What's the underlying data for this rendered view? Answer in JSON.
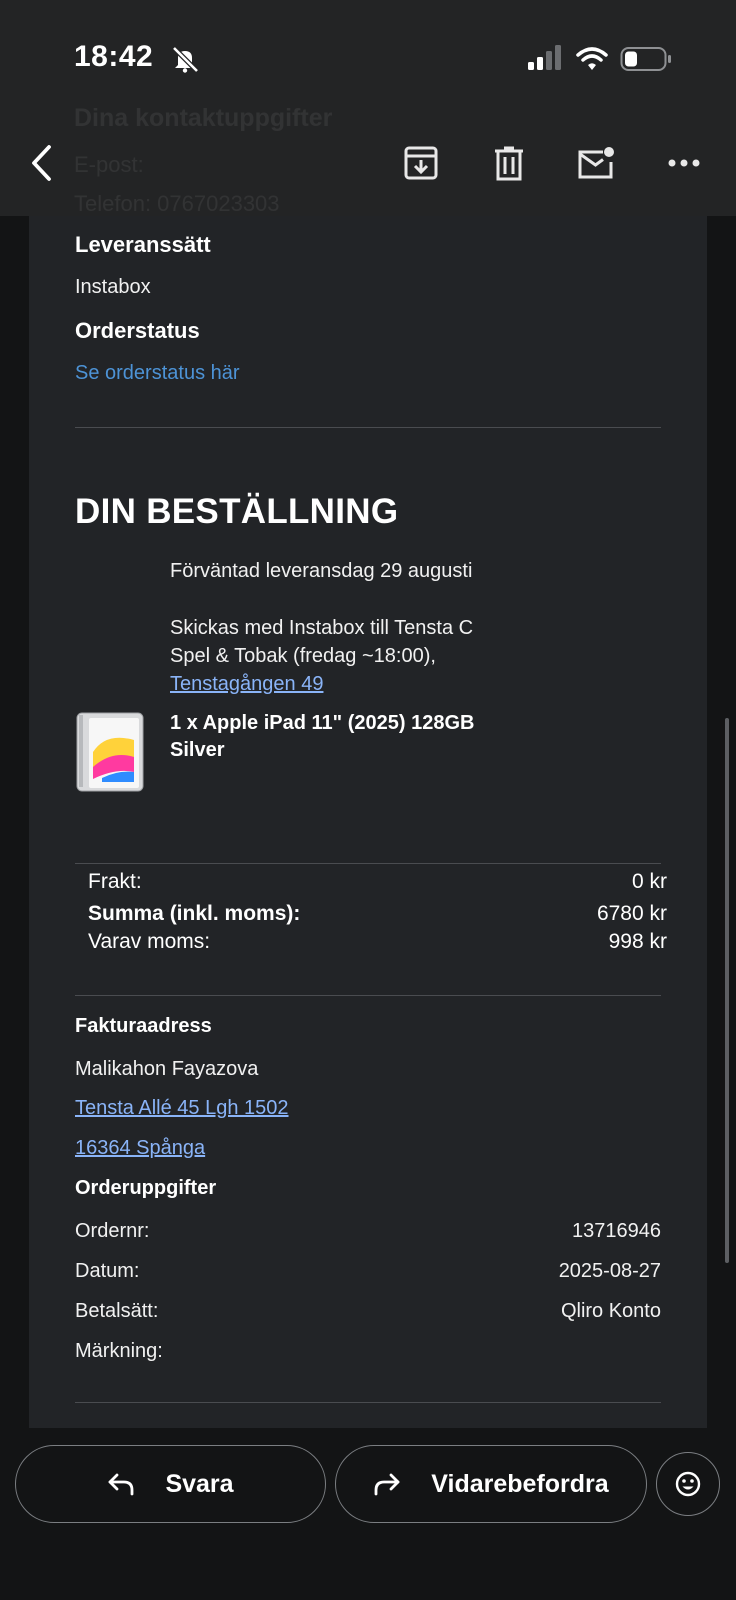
{
  "status_bar": {
    "time": "18:42"
  },
  "header_ghost": {
    "line1": "Dina kontaktuppgifter",
    "line2": "E-post: ",
    "line3": "Telefon: 0767023303"
  },
  "email": {
    "delivery_heading": "Leveranssätt",
    "delivery_value": "Instabox",
    "orderstatus_heading": "Orderstatus",
    "orderstatus_link": "Se orderstatus här",
    "order_title": "DIN BESTÄLLNING",
    "expected_delivery": "Förväntad leveransdag 29 augusti",
    "shipping_line1": "Skickas med Instabox till Tensta C",
    "shipping_line2": "Spel & Tobak (fredag ~18:00),",
    "shipping_address_link": "Tenstagången 49",
    "product_line1": "1 x Apple iPad 11\" (2025) 128GB",
    "product_line2": "Silver",
    "summary": {
      "shipping_label": "Frakt:",
      "shipping_value": "0 kr",
      "total_label": "Summa (inkl. moms):",
      "total_value": "6780 kr",
      "vat_label": "Varav moms:",
      "vat_value": "998 kr"
    },
    "billing": {
      "heading": "Fakturaadress",
      "name": "Malikahon Fayazova",
      "street_link": "Tensta Allé 45 Lgh 1502",
      "postal_link": "16364 Spånga"
    },
    "order_details": {
      "heading": "Orderuppgifter",
      "order_no_label": "Ordernr:",
      "order_no_value": "13716946",
      "date_label": "Datum:",
      "date_value": "2025-08-27",
      "payment_label": "Betalsätt:",
      "payment_value": "Qliro Konto",
      "marking_label": "Märkning:",
      "marking_value": ""
    }
  },
  "actions": {
    "reply_label": "Svara",
    "forward_label": "Vidarebefordra"
  },
  "icons": [
    "back-arrow-icon",
    "archive-icon",
    "trash-icon",
    "mark-unread-icon",
    "more-icon",
    "bell-slash-icon",
    "signal-icon",
    "wifi-icon",
    "battery-icon",
    "reply-icon",
    "forward-icon",
    "emoji-icon"
  ],
  "colors": {
    "background": "#131415",
    "topbar": "#232425",
    "email_bg": "#222427",
    "link": "#4d93d6",
    "underline_link": "#8ab4f8"
  }
}
